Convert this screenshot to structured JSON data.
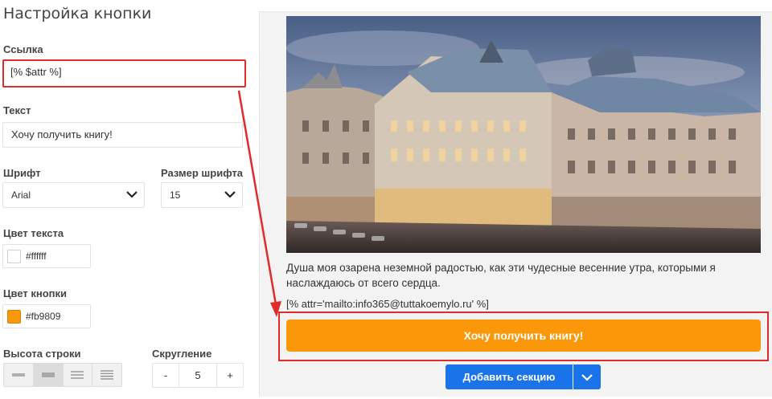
{
  "settings": {
    "title": "Настройка кнопки",
    "link_label": "Ссылка",
    "link_value": "[% $attr %]",
    "text_label": "Текст",
    "text_value": "Хочу получить книгу!",
    "font_label": "Шрифт",
    "font_value": "Arial",
    "font_size_label": "Размер шрифта",
    "font_size_value": "15",
    "text_color_label": "Цвет текста",
    "text_color_value": "#ffffff",
    "button_color_label": "Цвет кнопки",
    "button_color_value": "#fb9809",
    "line_height_label": "Высота строки",
    "radius_label": "Скругление",
    "radius_minus": "-",
    "radius_value": "5",
    "radius_plus": "+"
  },
  "preview": {
    "body_text": "Душа моя озарена неземной радостью, как эти чудесные весенние утра, которыми я наслаждаюсь от всего сердца.",
    "attr_text": "[% attr='mailto:info365@tuttakoemylo.ru' %]",
    "button_label": "Хочу получить книгу!",
    "add_section_label": "Добавить секцию"
  },
  "colors": {
    "accent_button": "#fb9809",
    "primary_blue": "#1a73e8",
    "highlight_red": "#e02b2b",
    "text_swatch": "#ffffff"
  },
  "icons": {
    "select_chevron": "chevron-down-icon",
    "add_caret": "chevron-down-icon",
    "annotation": "arrow-icon"
  }
}
